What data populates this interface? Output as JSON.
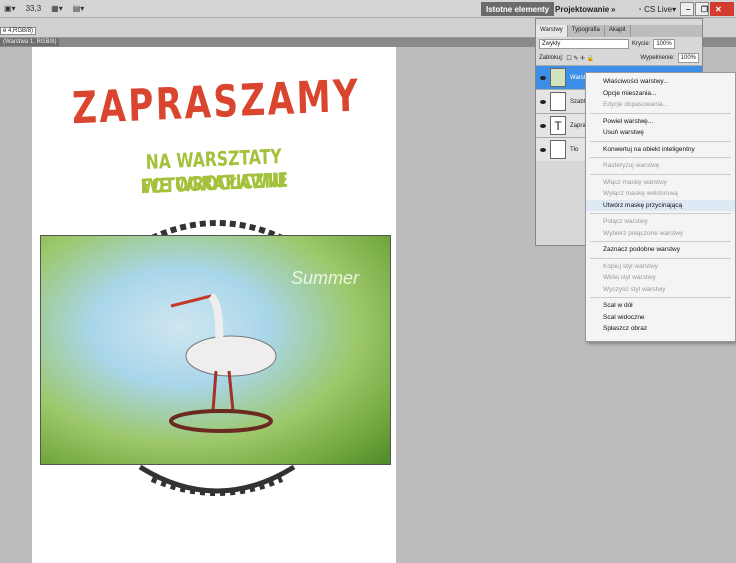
{
  "menubar": {
    "zoom": "33,3",
    "workspaces": [
      "Istotne elementy",
      "Projektowanie"
    ],
    "more": "»",
    "cslive": "CS Live"
  },
  "document": {
    "tab": "(Warstwa 1, RGB/8)",
    "tooltip": "e 4,RGB/8)"
  },
  "artwork": {
    "title": "ZAPRASZAMY",
    "line2": "NA WARSZTATY FOTOGRAFICZNE",
    "line3": "WE WROCŁAWIU",
    "watermark": "Summer",
    "colors": {
      "title": "#d9452e",
      "subtitle": "#a3c13a"
    }
  },
  "layers_panel": {
    "tabs": [
      "Warstwy",
      "Typografia",
      "Akapit"
    ],
    "blend_mode": "Zwykły",
    "opacity_label": "Krycie:",
    "opacity": "100%",
    "lock_label": "Zablokuj:",
    "fill_label": "Wypełnienie:",
    "fill": "100%",
    "layers": [
      {
        "name": "Warstwa 1",
        "selected": true
      },
      {
        "name": "Szablo"
      },
      {
        "name": "Zapra",
        "type": "text"
      },
      {
        "name": "Tło"
      }
    ]
  },
  "context_menu": {
    "items": [
      {
        "label": "Właściwości warstwy...",
        "enabled": true
      },
      {
        "label": "Opcje mieszania...",
        "enabled": true
      },
      {
        "label": "Edycje dopasowania...",
        "enabled": false
      },
      {
        "sep": true
      },
      {
        "label": "Powiel warstwę...",
        "enabled": true
      },
      {
        "label": "Usuń warstwę",
        "enabled": true
      },
      {
        "sep": true
      },
      {
        "label": "Konwertuj na obiekt inteligentny",
        "enabled": true
      },
      {
        "sep": true
      },
      {
        "label": "Rasteryzuj warstwę",
        "enabled": false
      },
      {
        "sep": true
      },
      {
        "label": "Włącz maskę warstwy",
        "enabled": false
      },
      {
        "label": "Wyłącz maskę wektorową",
        "enabled": false
      },
      {
        "label": "Utwórz maskę przycinającą",
        "enabled": true,
        "highlighted": true
      },
      {
        "sep": true
      },
      {
        "label": "Połącz warstwy",
        "enabled": false
      },
      {
        "label": "Wybierz połączone warstwy",
        "enabled": false
      },
      {
        "sep": true
      },
      {
        "label": "Zaznacz podobne warstwy",
        "enabled": true
      },
      {
        "sep": true
      },
      {
        "label": "Kopiuj styl warstwy",
        "enabled": false
      },
      {
        "label": "Wklej styl warstwy",
        "enabled": false
      },
      {
        "label": "Wyczyść styl warstwy",
        "enabled": false
      },
      {
        "sep": true
      },
      {
        "label": "Scal w dół",
        "enabled": true
      },
      {
        "label": "Scal widoczne",
        "enabled": true
      },
      {
        "label": "Spłaszcz obraz",
        "enabled": true
      }
    ]
  }
}
